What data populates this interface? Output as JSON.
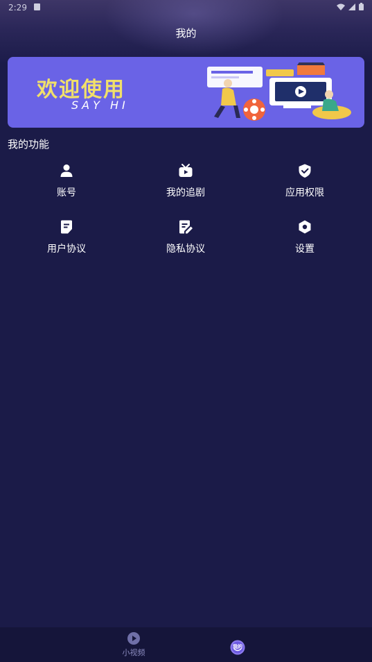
{
  "status_bar": {
    "time": "2:29"
  },
  "header": {
    "title": "我的"
  },
  "banner": {
    "title": "欢迎使用",
    "subtitle": "SAY HI"
  },
  "section": {
    "title": "我的功能"
  },
  "features": [
    {
      "label": "账号",
      "icon": "person-icon"
    },
    {
      "label": "我的追剧",
      "icon": "tv-icon"
    },
    {
      "label": "应用权限",
      "icon": "shield-check-icon"
    },
    {
      "label": "用户协议",
      "icon": "document-icon"
    },
    {
      "label": "隐私协议",
      "icon": "document-edit-icon"
    },
    {
      "label": "设置",
      "icon": "settings-hex-icon"
    }
  ],
  "bottom_nav": [
    {
      "label": "小视频",
      "icon": "play-circle-icon",
      "active": false
    },
    {
      "label": "我的",
      "icon": "profile-badge-icon",
      "active": true
    }
  ],
  "colors": {
    "background": "#1b1b48",
    "banner": "#6a63e6",
    "accent": "#7b6fe8"
  }
}
